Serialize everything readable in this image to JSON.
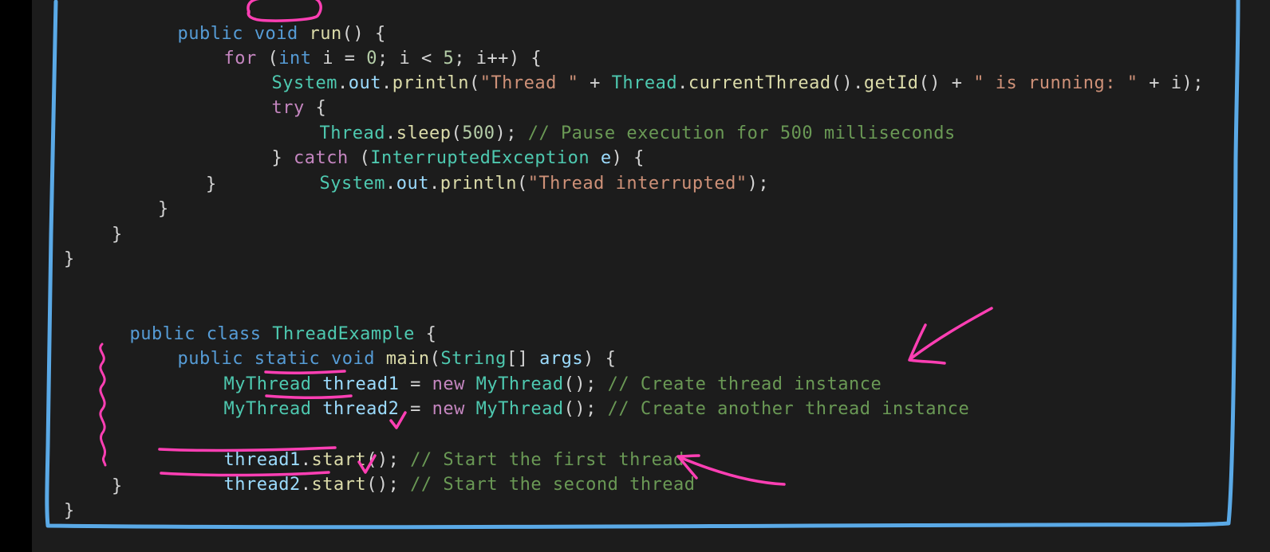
{
  "colors": {
    "background": "#1c1c1c",
    "frame": "#5aa9e6",
    "annotation_pink": "#ff3fb4",
    "keyword": "#569cd6",
    "control": "#c586c0",
    "type": "#4ec9b0",
    "function": "#dcdcaa",
    "variable": "#9cdcfe",
    "string": "#ce9178",
    "number": "#b5cea8",
    "comment": "#6a9955"
  },
  "code": {
    "l1": {
      "kw1": "public",
      "kw2": "void",
      "fn": "run",
      "rest": "() {"
    },
    "l2": {
      "ctl": "for",
      "p1": " (",
      "kw": "int",
      "p2": " i = ",
      "n1": "0",
      "p3": "; i < ",
      "n2": "5",
      "p4": "; i++) {"
    },
    "l3": {
      "t1": "System",
      "p1": ".",
      "v1": "out",
      "p2": ".",
      "f1": "println",
      "p3": "(",
      "s1": "\"Thread \"",
      "p4": " + ",
      "t2": "Thread",
      "p5": ".",
      "f2": "currentThread",
      "p6": "().",
      "f3": "getId",
      "p7": "() + ",
      "s2": "\" is running: \"",
      "p8": " + i);"
    },
    "l4": {
      "ctl": "try",
      "p": " {"
    },
    "l5": {
      "t": "Thread",
      "p1": ".",
      "f": "sleep",
      "p2": "(",
      "n": "500",
      "p3": "); ",
      "c": "// Pause execution for 500 milliseconds"
    },
    "l6": {
      "p1": "} ",
      "ctl": "catch",
      "p2": " (",
      "t": "InterruptedException",
      "v": " e",
      "p3": ") {"
    },
    "l7": {
      "t": "System",
      "p1": ".",
      "v": "out",
      "p2": ".",
      "f": "println",
      "p3": "(",
      "s": "\"Thread interrupted\"",
      "p4": ");"
    },
    "l8": "}",
    "l9": "}",
    "l10": "}",
    "l11": "}",
    "l12": {
      "kw1": "public",
      "kw2": "class",
      "t": "ThreadExample",
      "p": " {"
    },
    "l13": {
      "kw1": "public",
      "kw2": "static",
      "kw3": "void",
      "f": "main",
      "p1": "(",
      "t": "String",
      "p2": "[] ",
      "v": "args",
      "p3": ") {"
    },
    "l14": {
      "t1": "MyThread",
      "v": "thread1",
      "p1": " = ",
      "ctl": "new",
      "t2": " MyThread",
      "p2": "(); ",
      "c": "// Create thread instance"
    },
    "l15": {
      "t1": "MyThread",
      "v": "thread2",
      "p1": " = ",
      "ctl": "new",
      "t2": " MyThread",
      "p2": "(); ",
      "c": "// Create another thread instance"
    },
    "l16": {
      "v": "thread1",
      "p1": ".",
      "f": "start",
      "p2": "(); ",
      "c": "// Start the first thread"
    },
    "l17": {
      "v": "thread2",
      "p1": ".",
      "f": "start",
      "p2": "(); ",
      "c": "// Start the second thread"
    },
    "l18": "}",
    "l19": "}"
  }
}
